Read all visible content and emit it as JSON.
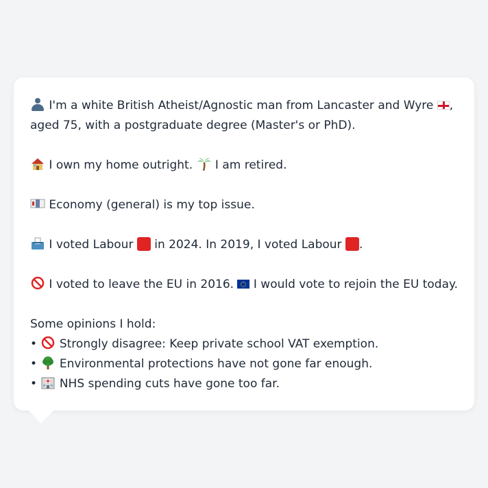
{
  "bio": {
    "line1_text": " I'm a white British Atheist/Agnostic man from Lancaster and Wyre ",
    "line1_after_flag": ",",
    "line2_text": "aged 75, with a postgraduate degree (Master's or PhD).",
    "home_text": " I own my home outright. ",
    "retired_text": " I am retired.",
    "issue_text": " Economy (general) is my top issue.",
    "vote_part1": " I voted Labour ",
    "vote_part2": " in 2024. In 2019, I voted Labour ",
    "vote_part3": ".",
    "eu_part1": " I voted to leave the EU in 2016. ",
    "eu_part2": " I would vote to rejoin the EU today.",
    "opinions_header": "Some opinions I hold:",
    "opinions": [
      " Strongly disagree: Keep private school VAT exemption.",
      " Environmental protections have not gone far enough.",
      " NHS spending cuts have gone too far."
    ],
    "bullet": "• "
  },
  "icons": {
    "person": "person-silhouette-icon",
    "england_flag": "england-flag-icon",
    "house": "house-icon",
    "palm": "palm-tree-icon",
    "money": "money-icon",
    "ballot": "ballot-box-icon",
    "party_square": "red-square-icon",
    "no_entry": "prohibited-icon",
    "eu_flag": "eu-flag-icon",
    "tree": "deciduous-tree-icon",
    "hospital": "hospital-icon"
  },
  "colors": {
    "labour_red": "#e02424",
    "background": "#f3f4f6",
    "bubble": "#ffffff",
    "text": "#1f2937"
  }
}
